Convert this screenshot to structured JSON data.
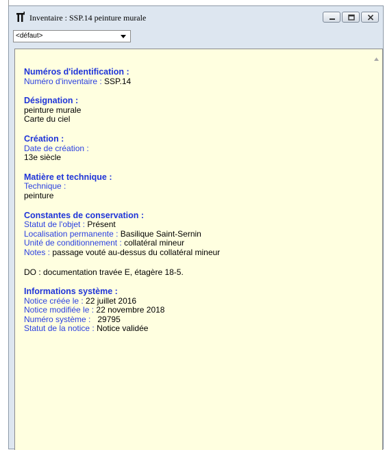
{
  "window": {
    "title": "Inventaire : SSP.14 peinture murale",
    "dropdown_value": "<défaut>"
  },
  "record": {
    "identification": {
      "heading": "Numéros d'identification :",
      "inventory_label": "Numéro d'inventaire : ",
      "inventory_value": "SSP.14"
    },
    "designation": {
      "heading": "Désignation :",
      "line1": "peinture murale",
      "line2": "Carte du ciel"
    },
    "creation": {
      "heading": "Création :",
      "date_label": "Date de création :",
      "date_value": "13e siècle"
    },
    "material": {
      "heading": "Matière et technique :",
      "technique_label": "Technique :",
      "technique_value": "peinture"
    },
    "conservation": {
      "heading": "Constantes de conservation :",
      "status_label": "Statut de l'objet : ",
      "status_value": "Présent",
      "location_label": "Localisation permanente : ",
      "location_value": "Basilique Saint-Sernin",
      "unit_label": "Unité de conditionnement : ",
      "unit_value": "collatéral mineur",
      "notes_label": "Notes : ",
      "notes_value": "passage vouté au-dessus du collatéral mineur"
    },
    "do_line": "DO : documentation travée E, étagère 18-5.",
    "system": {
      "heading": "Informations système :",
      "created_label": "Notice créée le : ",
      "created_value": "22 juillet 2016",
      "modified_label": "Notice modifiée le : ",
      "modified_value": "22 novembre 2018",
      "sysnum_label": "Numéro système : ",
      "sysnum_value": "  29795",
      "notice_status_label": "Statut de la notice : ",
      "notice_status_value": "Notice validée"
    }
  }
}
